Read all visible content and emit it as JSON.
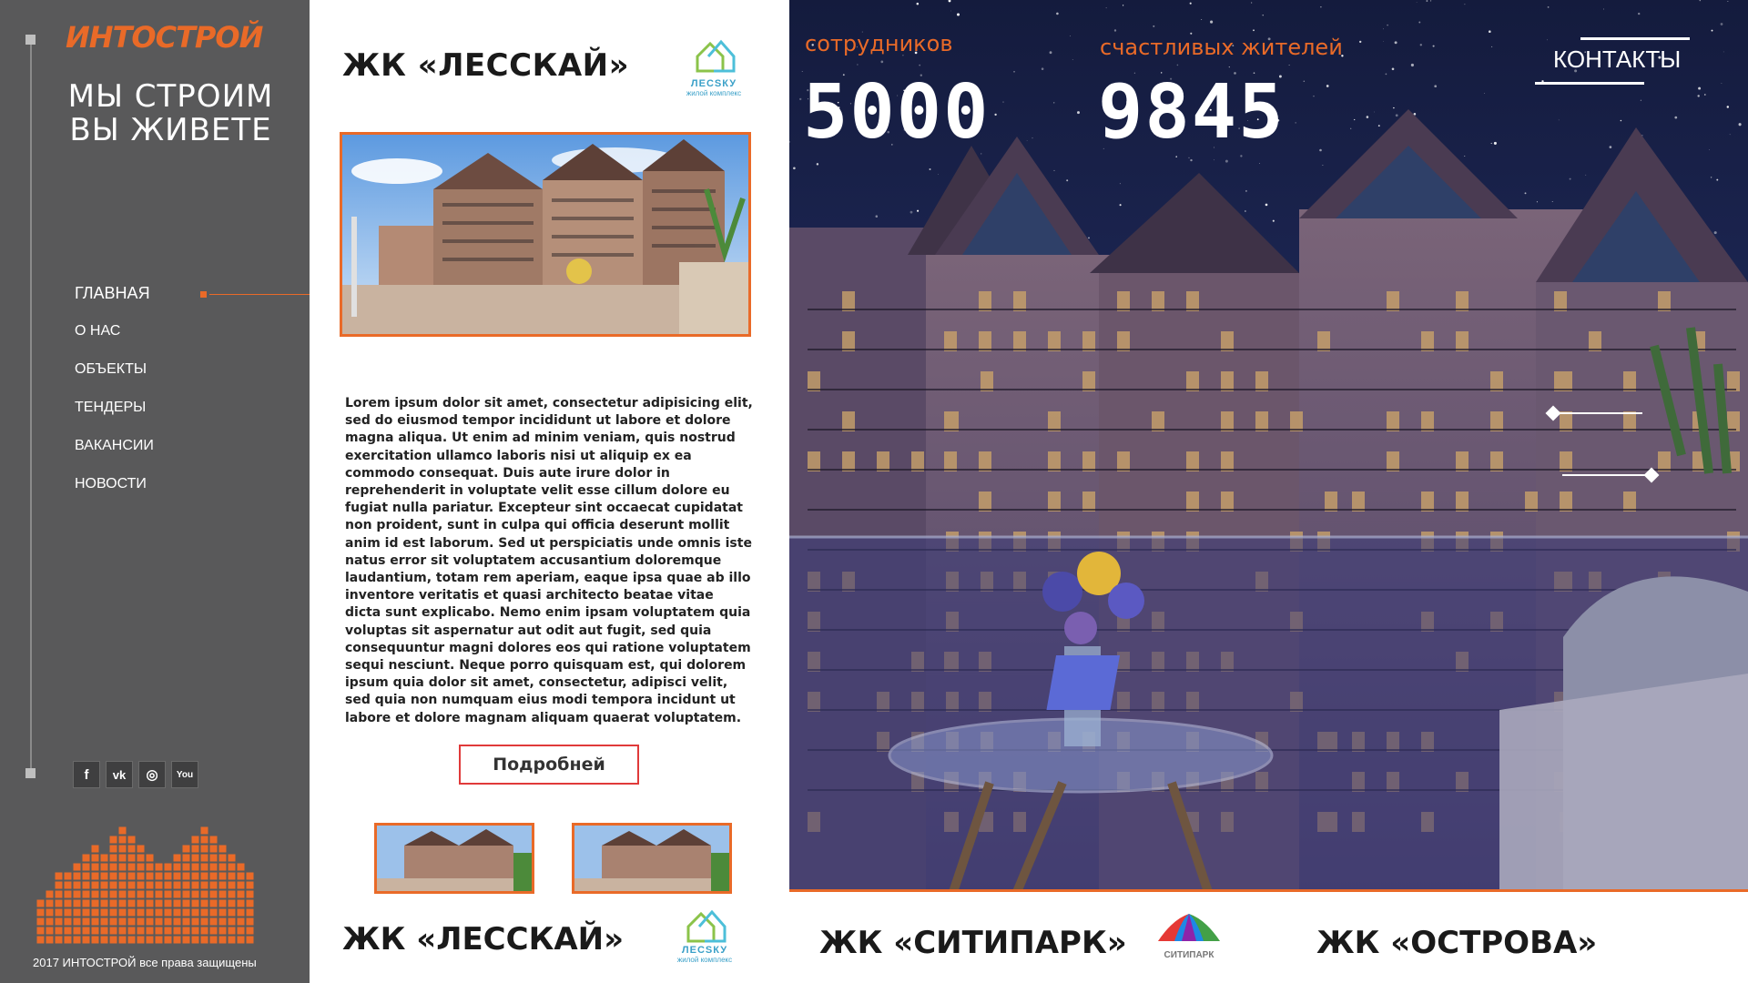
{
  "brand": {
    "logo": "ИНТОСТРОЙ",
    "slogan_line1": "МЫ СТРОИМ",
    "slogan_line2": "ВЫ ЖИВЕТЕ"
  },
  "nav": {
    "items": [
      {
        "label": "ГЛАВНАЯ",
        "active": true
      },
      {
        "label": "О НАС",
        "active": false
      },
      {
        "label": "ОБЪЕКТЫ",
        "active": false
      },
      {
        "label": "ТЕНДЕРЫ",
        "active": false
      },
      {
        "label": "ВАКАНСИИ",
        "active": false
      },
      {
        "label": "НОВОСТИ",
        "active": false
      }
    ]
  },
  "social": {
    "facebook": "f",
    "vk": "vk",
    "instagram": "◎",
    "youtube": "You"
  },
  "footer": {
    "copyright": "2017 ИНТОСТРОЙ все права защищены"
  },
  "project": {
    "title": "ЖК «ЛЕССКАЙ»",
    "logo_text": "ЛЕСSКУ",
    "logo_sub": "жилой комплекс",
    "description": "Lorem ipsum dolor sit amet, consectetur adipisicing elit, sed do eiusmod tempor incididunt ut labore et dolore magna aliqua. Ut enim ad minim veniam, quis nostrud exercitation ullamco laboris nisi ut aliquip ex ea commodo consequat. Duis aute irure dolor in reprehenderit in voluptate velit esse cillum dolore eu fugiat nulla pariatur. Excepteur sint occaecat cupidatat non proident, sunt in culpa qui officia deserunt mollit anim id est laborum. Sed ut perspiciatis unde omnis iste natus error sit voluptatem accusantium doloremque laudantium, totam rem aperiam, eaque ipsa quae ab illo inventore veritatis et quasi architecto beatae vitae dicta sunt explicabo. Nemo enim ipsam voluptatem quia voluptas sit aspernatur aut odit aut fugit, sed quia consequuntur magni dolores eos qui ratione voluptatem sequi nesciunt. Neque porro quisquam est, qui dolorem ipsum quia dolor sit amet, consectetur, adipisci velit, sed quia non numquam eius modi tempora incidunt ut labore et dolore magnam aliquam quaerat voluptatem.",
    "more_button": "Подробней"
  },
  "stats": {
    "employees_label": "сотрудников",
    "employees_value": "5000",
    "residents_label": "счастливых жителей",
    "residents_value": "9845"
  },
  "header": {
    "contacts": "КОНТАКТЫ"
  },
  "bottom": {
    "lesskay": "ЖК «ЛЕССКАЙ»",
    "lesskay_logo": "ЛЕСSКУ",
    "lesskay_logo_sub": "жилой комплекс",
    "citypark": "ЖК «СИТИПАРК»",
    "citypark_logo": "СИТИПАРК",
    "ostrova": "ЖК «ОСТРОВА»"
  },
  "colors": {
    "accent": "#e96a28",
    "sidebar": "#59595a",
    "night_sky": "#1b2552"
  }
}
